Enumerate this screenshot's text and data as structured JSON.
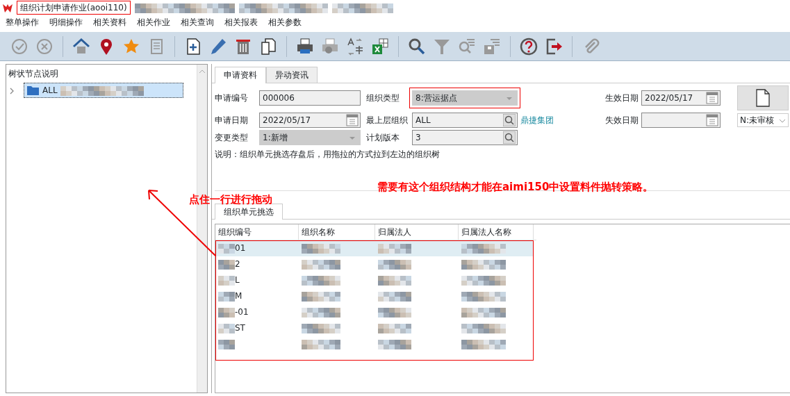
{
  "window": {
    "title": "组织计划申请作业(aooi110)"
  },
  "menu": [
    "整单操作",
    "明细操作",
    "相关资料",
    "相关作业",
    "相关查询",
    "相关报表",
    "相关参数"
  ],
  "tree": {
    "header": "树状节点说明",
    "items": [
      {
        "label": "ALL",
        "expanded": false,
        "selected": true
      }
    ]
  },
  "tabs": [
    {
      "label": "申请资料",
      "selected": true
    },
    {
      "label": "异动资讯",
      "selected": false
    }
  ],
  "form": {
    "fields": [
      {
        "label": "申请编号",
        "value": "000006",
        "kind": "text"
      },
      {
        "label": "组织类型",
        "value": "8:营运据点",
        "kind": "select"
      },
      {
        "label": "生效日期",
        "value": "2022/05/17",
        "kind": "date"
      },
      {
        "label": "申请日期",
        "value": "2022/05/17",
        "kind": "date"
      },
      {
        "label": "最上层组织",
        "value": "ALL",
        "kind": "lookup",
        "link": "鼎捷集团"
      },
      {
        "label": "失效日期",
        "kind": "date"
      },
      {
        "label": "变更类型",
        "value": "1:新增",
        "kind": "select"
      },
      {
        "label": "计划版本",
        "value": "3",
        "kind": "lookup"
      }
    ],
    "note": "说明：组织单元挑选存盘后，用拖拉的方式拉到左边的组织树",
    "status": "N:未审核"
  },
  "lower_tabs": [
    {
      "label": "组织单元挑选",
      "selected": true
    }
  ],
  "table": {
    "columns": [
      "组织编号",
      "组织名称",
      "归属法人",
      "归属法人名称"
    ],
    "rows": [
      {
        "code": "01",
        "selected": true
      },
      {
        "code": "2",
        "selected": false
      },
      {
        "code": "L",
        "selected": false
      },
      {
        "code": "M",
        "selected": false
      },
      {
        "code": "-01",
        "selected": false
      },
      {
        "code": "ST",
        "selected": false
      },
      {
        "selected": false
      }
    ]
  },
  "annotations": [
    {
      "text": "需要有这个组织结构才能在aimi150中设置料件抛转策略。",
      "kind": "note"
    },
    {
      "text": "点住一行进行拖动",
      "kind": "arrow"
    }
  ]
}
